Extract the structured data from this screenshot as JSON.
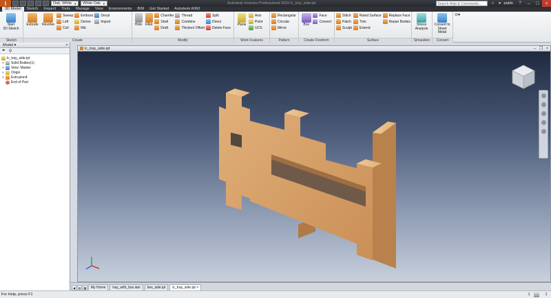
{
  "titlebar": {
    "material": "Oak, White",
    "appearance": "White Oak",
    "title": "Autodesk Inventor Professional 2015  lc_tray_side.ipt",
    "search_placeholder": "Search Help & Commands...",
    "user": "pablo"
  },
  "ribbon_tabs": [
    "3D Model",
    "Sketch",
    "Inspect",
    "Tools",
    "Manage",
    "View",
    "Environments",
    "BIM",
    "Get Started",
    "Autodesk A360"
  ],
  "ribbon": {
    "sketch": {
      "label": "Sketch",
      "start_sketch": "Start\n2D Sketch"
    },
    "create": {
      "label": "Create",
      "extrude": "Extrude",
      "revolve": "Revolve",
      "col1": [
        "Sweep",
        "Loft",
        "Coil"
      ],
      "col2": [
        "Emboss",
        "Derive",
        "Rib"
      ],
      "col3": [
        "Decal",
        "Import"
      ]
    },
    "modify": {
      "label": "Modify",
      "hole": "Hole",
      "fillet": "Fillet",
      "col1": [
        "Chamfer",
        "Shell",
        "Draft"
      ],
      "col2": [
        "Thread",
        "Combine",
        "Thicken/ Offset"
      ],
      "col3": [
        "Split",
        "Direct",
        "Delete Face"
      ]
    },
    "work": {
      "label": "Work Features",
      "plane": "Plane",
      "col1": [
        "Axis",
        "Point",
        "UCS"
      ]
    },
    "pattern": {
      "label": "Pattern",
      "col1": [
        "Rectangular",
        "Circular",
        "Mirror"
      ]
    },
    "freeform": {
      "label": "Create Freeform",
      "box": "Box",
      "col1": [
        "Face",
        "Convert"
      ]
    },
    "surface": {
      "label": "Surface",
      "col1": [
        "Stitch",
        "Patch",
        "Sculpt"
      ],
      "col2": [
        "Ruled Surface",
        "Trim",
        "Extend"
      ],
      "col3": [
        "Replace Face",
        "Repair Bodies"
      ]
    },
    "simulation": {
      "label": "Simulation",
      "stress": "Stress\nAnalysis"
    },
    "convert": {
      "label": "Convert",
      "sheet_metal": "Convert to\nSheet Metal"
    }
  },
  "browser": {
    "header": "Model",
    "tree": [
      "lc_tray_side.ipt",
      "Solid Bodies(1)",
      "View: Master",
      "Origin",
      "Extrusion4",
      "End of Part"
    ]
  },
  "document": {
    "title": "lc_tray_side.ipt"
  },
  "doc_tabs": [
    "My Home",
    "tray_with_box.iam",
    "box_side.ipt",
    "lc_tray_side.ipt"
  ],
  "status": {
    "help": "For Help, press F1",
    "count1": "1",
    "count2": "1"
  }
}
